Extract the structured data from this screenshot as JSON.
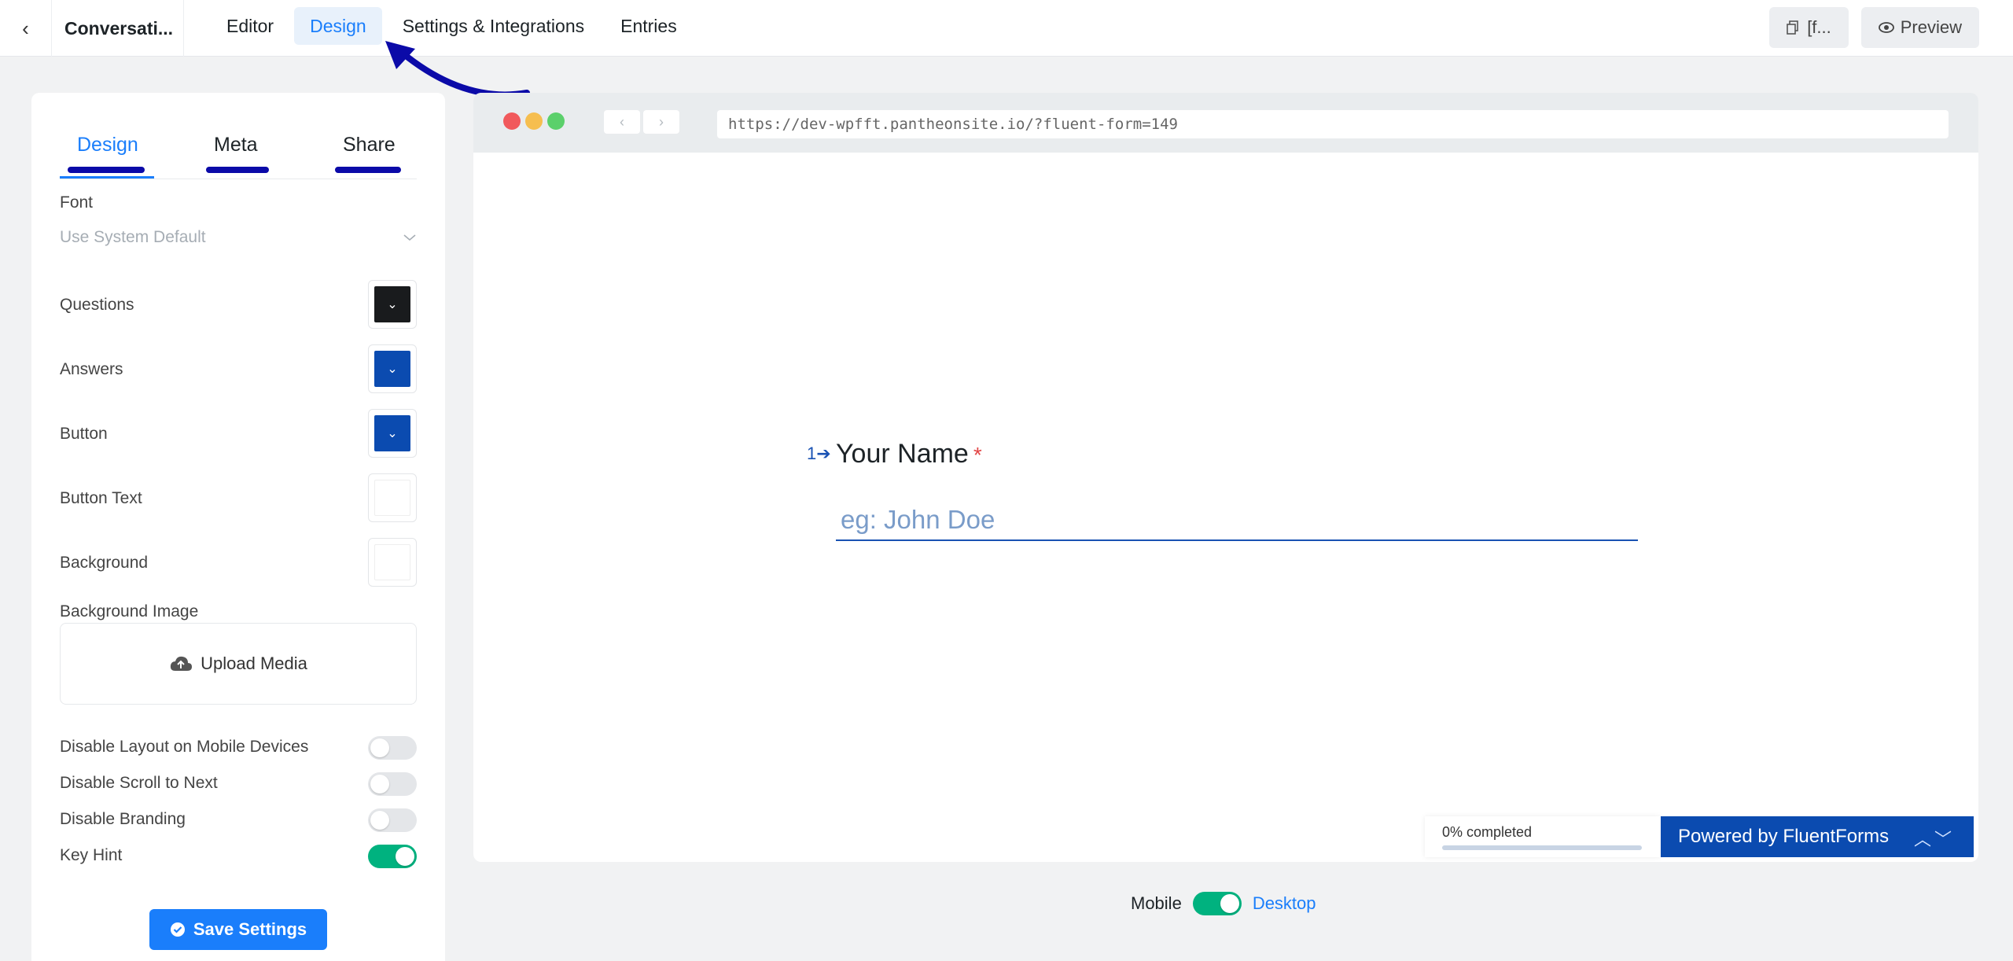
{
  "topbar": {
    "back_icon": "chevron-left-icon",
    "form_name": "Conversati...",
    "tabs": [
      {
        "label": "Editor",
        "active": false
      },
      {
        "label": "Design",
        "active": true
      },
      {
        "label": "Settings & Integrations",
        "active": false
      },
      {
        "label": "Entries",
        "active": false
      }
    ],
    "shortcode_label": "[f...",
    "preview_label": "Preview"
  },
  "sidebar": {
    "subtabs": [
      {
        "label": "Design",
        "active": true
      },
      {
        "label": "Meta",
        "active": false
      },
      {
        "label": "Share",
        "active": false
      }
    ],
    "font_label": "Font",
    "font_value": "Use System Default",
    "colors": [
      {
        "label": "Questions",
        "color": "#191b1d"
      },
      {
        "label": "Answers",
        "color": "#0b4bb0"
      },
      {
        "label": "Button",
        "color": "#0b4bb0"
      },
      {
        "label": "Button Text",
        "color": "#ffffff"
      },
      {
        "label": "Background",
        "color": "#ffffff"
      }
    ],
    "bg_image_label": "Background Image",
    "upload_label": "Upload Media",
    "toggles": [
      {
        "label": "Disable Layout on Mobile Devices",
        "on": false
      },
      {
        "label": "Disable Scroll to Next",
        "on": false
      },
      {
        "label": "Disable Branding",
        "on": false
      },
      {
        "label": "Key Hint",
        "on": true
      }
    ],
    "save_label": "Save Settings"
  },
  "browser": {
    "url": "https://dev-wpfft.pantheonsite.io/?fluent-form=149",
    "question": {
      "number": "1",
      "title": "Your Name",
      "required_mark": "*",
      "placeholder": "eg: John Doe"
    },
    "progress_text": "0% completed",
    "progress": 0,
    "powered_prefix": "Powered by ",
    "powered_brand": "FluentForms"
  },
  "device_toggle": {
    "mobile_label": "Mobile",
    "desktop_label": "Desktop",
    "desktop_on": true
  },
  "colors": {
    "accent": "#1a7efb",
    "brand_dark": "#0b4bb0",
    "toggle_on": "#00b27f",
    "annotation": "#0b0aa8"
  }
}
